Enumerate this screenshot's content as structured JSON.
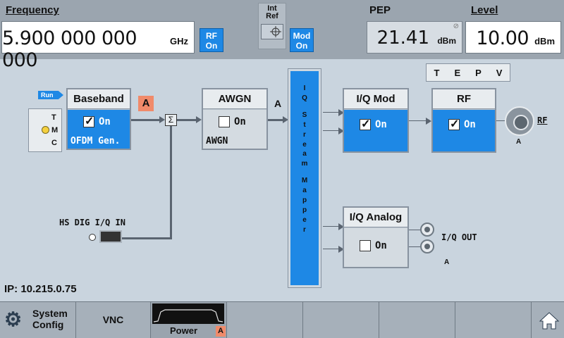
{
  "topbar": {
    "frequency_label": "Frequency",
    "frequency_value": "5.900 000 000 000",
    "frequency_unit": "GHz",
    "rf_toggle": {
      "line1": "RF",
      "line2": "On"
    },
    "ref_label": {
      "line1": "Int",
      "line2": "Ref"
    },
    "mod_toggle": {
      "line1": "Mod",
      "line2": "On"
    },
    "pep_label": "PEP",
    "pep_value": "21.41",
    "pep_unit": "dBm",
    "pep_icon": "⊘",
    "level_label": "Level",
    "level_value": "10.00",
    "level_unit": "dBm"
  },
  "diagram": {
    "run_tag": "Run",
    "tmc": {
      "t": "T",
      "m": "M",
      "c": "C"
    },
    "baseband": {
      "title": "Baseband",
      "state": "On",
      "checked": true,
      "sub": "OFDM Gen.",
      "badge": "A"
    },
    "sigma": "Σ",
    "awgn": {
      "title": "AWGN",
      "state": "On",
      "checked": false,
      "sub": "AWGN",
      "path": "A"
    },
    "stream_mapper": {
      "letters": [
        "I",
        "Q",
        "S",
        "t",
        "r",
        "e",
        "a",
        "m",
        "M",
        "a",
        "p",
        "p",
        "e",
        "r"
      ]
    },
    "iq_mod": {
      "title": "I/Q Mod",
      "state": "On",
      "checked": true
    },
    "rf": {
      "title": "RF",
      "state": "On",
      "checked": true
    },
    "tepv": [
      "T",
      "E",
      "P",
      "V"
    ],
    "rf_port": {
      "label": "RF",
      "path": "A"
    },
    "iq_analog": {
      "title": "I/Q Analog",
      "state": "On",
      "checked": false
    },
    "iq_out": {
      "label": "I/Q OUT",
      "path": "A"
    },
    "hs_dig": {
      "label": "HS DIG I/Q IN"
    }
  },
  "ip_label": "IP: 10.215.0.75",
  "taskbar": {
    "system_config": {
      "line1": "System",
      "line2": "Config",
      "icon": "gear-icon"
    },
    "vnc": "VNC",
    "power": {
      "label": "Power",
      "badge": "A"
    },
    "home_icon": "home-icon"
  },
  "colors": {
    "accent": "#1e88e5",
    "badge": "#f08a6a",
    "panel": "#c9d4de",
    "bar": "#9ba5af"
  }
}
